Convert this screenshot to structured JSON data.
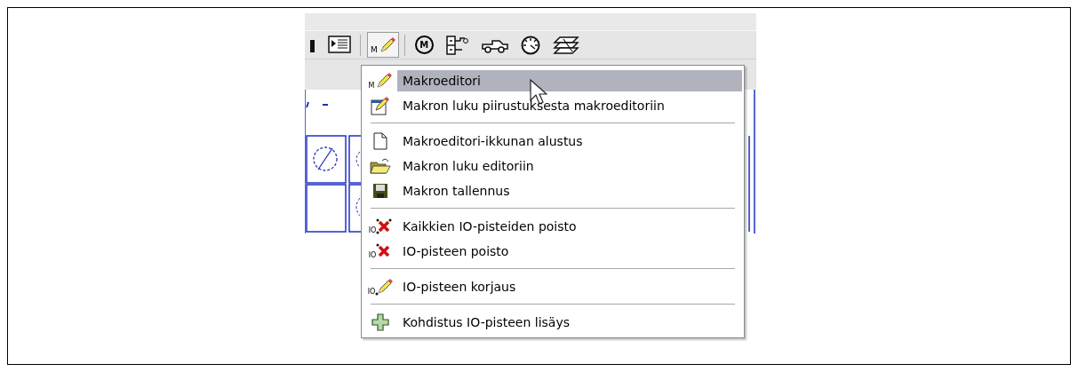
{
  "toolbar": {
    "items": [
      {
        "kind": "partial"
      },
      {
        "kind": "list"
      },
      {
        "kind": "separator"
      },
      {
        "kind": "pencil",
        "pressed": true,
        "icon_text": "M"
      },
      {
        "kind": "separator"
      },
      {
        "kind": "motor",
        "icon_text": "M"
      },
      {
        "kind": "diagram"
      },
      {
        "kind": "car"
      },
      {
        "kind": "gauge"
      },
      {
        "kind": "layers"
      }
    ]
  },
  "menu": {
    "items": [
      {
        "kind": "pencil",
        "icon_text": "M",
        "label": "Makroeditori",
        "selected": true
      },
      {
        "kind": "editdoc",
        "label": "Makron luku piirustuksesta makroeditoriin",
        "selected": false
      },
      {
        "kind": "separator"
      },
      {
        "kind": "page",
        "label": "Makroeditori-ikkunan alustus",
        "selected": false
      },
      {
        "kind": "folder",
        "label": "Makron luku editoriin",
        "selected": false
      },
      {
        "kind": "floppy",
        "label": "Makron tallennus",
        "selected": false
      },
      {
        "kind": "separator"
      },
      {
        "kind": "crossdots",
        "icon_text": "IO",
        "label": "Kaikkien IO-pisteiden poisto",
        "selected": false
      },
      {
        "kind": "cross",
        "icon_text": "IO",
        "label": "IO-pisteen poisto",
        "selected": false
      },
      {
        "kind": "separator"
      },
      {
        "kind": "pencildot",
        "icon_text": "IO",
        "label": "IO-pisteen korjaus",
        "selected": false
      },
      {
        "kind": "separator"
      },
      {
        "kind": "plus",
        "label": "Kohdistus IO-pisteen lisäys",
        "selected": false
      }
    ]
  }
}
